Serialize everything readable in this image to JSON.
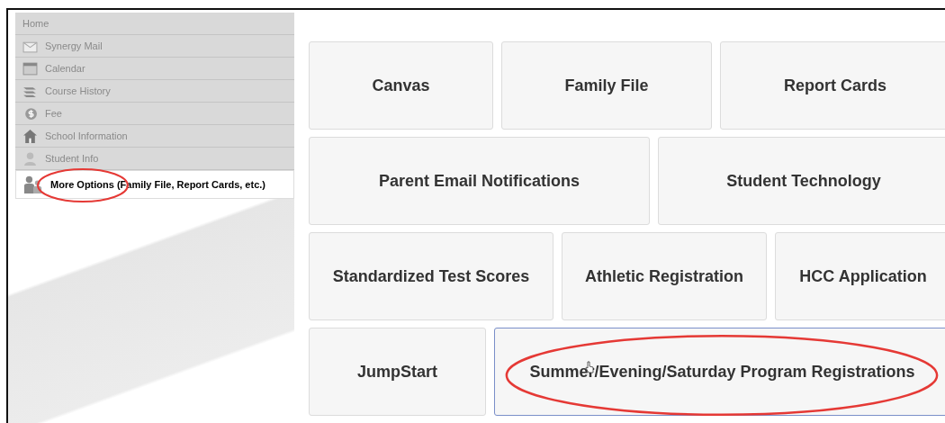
{
  "sidebar": {
    "items": [
      {
        "label": "Home",
        "selected": false,
        "circled": false
      },
      {
        "label": "Synergy Mail",
        "selected": false,
        "circled": false
      },
      {
        "label": "Calendar",
        "selected": false,
        "circled": false
      },
      {
        "label": "Course History",
        "selected": false,
        "circled": false
      },
      {
        "label": "Fee",
        "selected": false,
        "circled": false
      },
      {
        "label": "School Information",
        "selected": false,
        "circled": false
      },
      {
        "label": "Student Info",
        "selected": false,
        "circled": false
      },
      {
        "label": "More Options (Family File, Report Cards, etc.)",
        "selected": true,
        "circled": true
      }
    ]
  },
  "tiles": [
    [
      {
        "label": "Canvas",
        "selected": false,
        "circled": false
      },
      {
        "label": "Family File",
        "selected": false,
        "circled": false
      },
      {
        "label": "Report Cards",
        "selected": false,
        "circled": false
      }
    ],
    [
      {
        "label": "Parent Email Notifications",
        "selected": false,
        "circled": false
      },
      {
        "label": "Student Technology",
        "selected": false,
        "circled": false
      }
    ],
    [
      {
        "label": "Standardized Test Scores",
        "selected": false,
        "circled": false
      },
      {
        "label": "Athletic Registration",
        "selected": false,
        "circled": false
      },
      {
        "label": "HCC Application",
        "selected": false,
        "circled": false
      }
    ],
    [
      {
        "label": "JumpStart",
        "selected": false,
        "circled": false
      },
      {
        "label": "Summer/Evening/Saturday Program Registrations",
        "selected": true,
        "circled": true
      }
    ]
  ]
}
